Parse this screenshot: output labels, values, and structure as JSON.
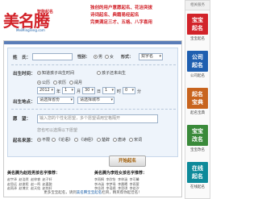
{
  "header": {
    "logo_text": "美名腾",
    "brand_text": "智能起名",
    "url_text": "MeiMingTeng.com",
    "slogan_lines": [
      {
        "red": "独创的",
        "text": "用户意愿起名、花洁突拔"
      },
      {
        "red": "",
        "text": "诗词起名、典籍易经起名"
      },
      {
        "red": "",
        "text": "完美满足三才、五格、八字喜用"
      }
    ]
  },
  "form": {
    "surname_label": "姓　氏：",
    "gender_label": "性别：",
    "gender_male": "男",
    "gender_female": "女",
    "form_label": "形式：",
    "form_value": "双字名",
    "birth_label": "出生时间：",
    "birth_known": "知道孩子出生时间",
    "birth_unknown": "孩子还未出生",
    "calendar_solar": "公历",
    "calendar_lunar": "农历",
    "calendar_leap": "闰月",
    "year_value": "2012",
    "year_unit": "年",
    "month_value": "1",
    "month_unit": "月",
    "day_value": "30",
    "day_unit": "日",
    "hour_value": "1",
    "hour_unit": "时",
    "minute_value": "0",
    "minute_unit": "分",
    "birthplace_label": "出生地点：",
    "birthplace_value": "请选择省份",
    "birthplace_city": "请选择城市",
    "wish_label": "愿　望：",
    "wish_placeholder": "输入您的个性化愿望，多个愿望请用空格隔开",
    "wish_note": "您也可以选择以下愿望",
    "source_label": "起名来源：",
    "source_options": [
      "不限",
      "《论语》",
      "《诗经》",
      "楚辞",
      "唐诗",
      "宋词"
    ],
    "submit_label": "开始起名"
  },
  "samples": {
    "boy_title": "美名腾为赵姓男孩名字推荐：",
    "boy_names": "赵宇泽  赵浩然  赵梓睿  赵子轩\n赵思远  赵俊熙  赵一鸣  赵嘉懿\n赵雨泽  赵博文  赵天佑  赵铭轩",
    "girl_title": "美名腾为李姓女孩名字推荐：",
    "girl_names": "李雨桐  李欣怡  李梓涵  李可馨\n李诗涵  李梦瑶  李晨曦  李雨萱\n李佳琪  李语嫣  李思琪  李若汐"
  },
  "footer": {
    "prefix": "更多宝宝起名，请到",
    "link": "美名腾宝宝起名",
    "suffix": "栏目，精英帮你起佳名！"
  },
  "sidebar": {
    "head": "相关服务",
    "items": [
      {
        "tile": "宝宝\n起名",
        "caption": "宝宝起名",
        "color": "#d2232a"
      },
      {
        "tile": "公司\n起名",
        "caption": "公司起名",
        "color": "#1f5fb0"
      },
      {
        "tile": "起名\n宝典",
        "caption": "起名宝典",
        "color": "#c8641e"
      },
      {
        "tile": "宝宝\n改名",
        "caption": "宝宝改名",
        "color": "#3a8a3a"
      },
      {
        "tile": "在线\n起名",
        "caption": "在线起名",
        "color": "#0e8a9a"
      }
    ]
  }
}
